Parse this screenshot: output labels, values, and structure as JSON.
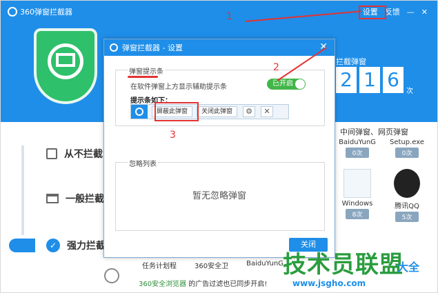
{
  "app": {
    "title": "360弹窗拦截器",
    "settings": "设置",
    "feedback": "反馈",
    "minimize": "—",
    "close": "✕"
  },
  "header": {
    "counter_label": "拦截弹窗",
    "digits": [
      "2",
      "1",
      "6"
    ],
    "unit": "次"
  },
  "modes": [
    {
      "label": "从不拦截"
    },
    {
      "label": "一般拦截"
    },
    {
      "label": "强力拦截"
    }
  ],
  "right_panel": {
    "heading": "中间弹窗、网页弹窗",
    "tiles": [
      {
        "name": "BaiduYunG",
        "count": "0次"
      },
      {
        "name": "Setup.exe",
        "count": "0次"
      },
      {
        "name": "Windows",
        "count": "8次"
      },
      {
        "name": "腾讯QQ",
        "count": "5次"
      }
    ]
  },
  "bottom": {
    "items": [
      "任务计划程",
      "360安全卫",
      "BaiduYunG"
    ],
    "note_prefix": "360安全浏览器",
    "note_suffix": "的广告过滤也已同步开启!"
  },
  "dialog": {
    "title": "弹窗拦截器 - 设置",
    "group1_title": "弹窗提示条",
    "desc": "在软件弹窗上方显示辅助提示条",
    "toggle_label": "已开启",
    "bar_label": "提示条如下：",
    "bar_btn1": "屏蔽此弹窗",
    "bar_btn2": "关闭此弹窗",
    "gear": "⚙",
    "x": "✕",
    "group2_title": "忽略列表",
    "empty_text": "暂无忽略弹窗",
    "close_button": "关闭"
  },
  "annotations": {
    "n1": "1",
    "n2": "2",
    "n3": "3"
  },
  "watermark": {
    "main": "技术员联盟",
    "sub": "www.jsgho.com",
    "right": "大全"
  },
  "colors": {
    "primary": "#1f8ee8",
    "green": "#42b649",
    "annotation_red": "#e23333"
  }
}
